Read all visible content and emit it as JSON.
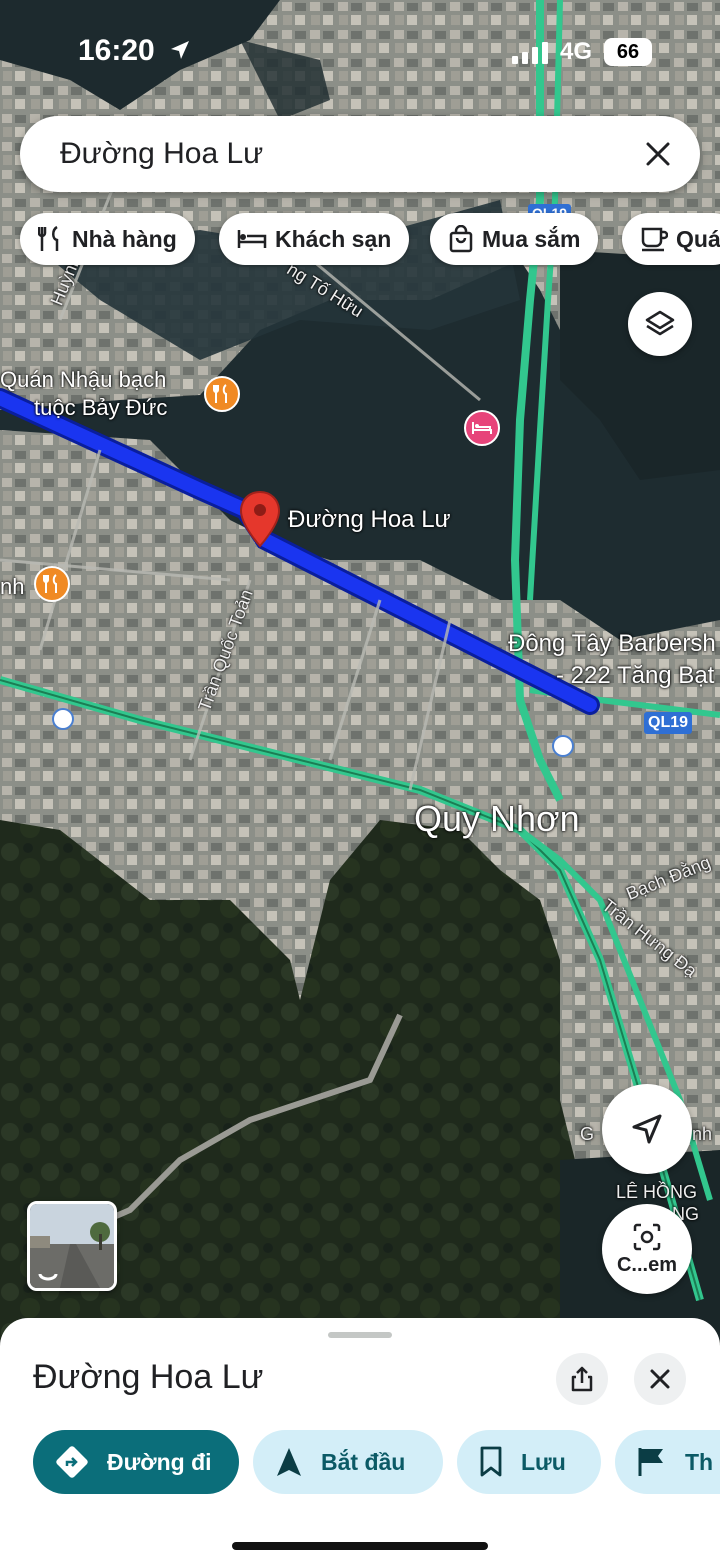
{
  "status_bar": {
    "time": "16:20",
    "network": "4G",
    "battery": "66"
  },
  "search": {
    "value": "Đường Hoa Lư"
  },
  "chips": [
    {
      "label": "Nhà hàng",
      "icon": "fork-knife-icon"
    },
    {
      "label": "Khách sạn",
      "icon": "bed-icon"
    },
    {
      "label": "Mua sắm",
      "icon": "shopping-bag-icon"
    },
    {
      "label": "Quá",
      "icon": "coffee-cup-icon"
    }
  ],
  "map": {
    "pin_label": "Đường Hoa Lư",
    "city_label": "Quy Nhơn",
    "poi": {
      "restaurant_1": [
        "Quán Nhậu bạch",
        "tuộc Bảy Đức"
      ],
      "restaurant_2": "nh",
      "barber": [
        "Đông Tây Barbersh",
        "- 222 Tăng Bạt"
      ]
    },
    "streets": {
      "to_huu": "ng Tố Hữu",
      "huynh": "Huỳnh",
      "tran_quoc_toan": "Trần Quốc Toản",
      "bach_dang": "Bạch Đằng",
      "tran_hung_dao": "Trần Hưng Đạ",
      "le_hong": "LÊ HỒNG",
      "le_hong_2": "NG",
      "ga_label": "G",
      "nh_label": "nh"
    },
    "road_shields": [
      "QL19",
      "QL19"
    ],
    "colors": {
      "route": "#1a35f0",
      "highway": "#32c78e",
      "pin": "#e5372c"
    }
  },
  "controls": {
    "layers_icon": "layers-icon",
    "my_location_icon": "navigation-arrow-icon",
    "lens_label": "C...em"
  },
  "sheet": {
    "title": "Đường Hoa Lư",
    "actions": {
      "directions": "Đường đi",
      "start": "Bắt đầu",
      "save": "Lưu",
      "more": "Th"
    }
  }
}
